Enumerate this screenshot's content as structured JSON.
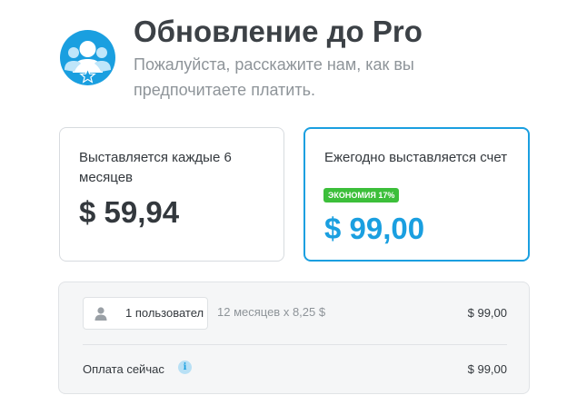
{
  "header": {
    "title": "Обновление до Pro",
    "subtitle": "Пожалуйста, расскажите нам, как вы предпочитаете платить.",
    "logo_icon": "users-star-icon",
    "accent_color": "#1a9fe0"
  },
  "plans": [
    {
      "label": "Выставляется каждые 6 месяцев",
      "price": "$ 59,94",
      "selected": false
    },
    {
      "label": "Ежегодно выставляется счет",
      "badge": "ЭКОНОМИЯ 17%",
      "badge_color": "#3cbf3a",
      "price": "$ 99,00",
      "selected": true
    }
  ],
  "summary": {
    "users_select_value": "1 пользовател",
    "user_icon": "user-icon",
    "months_text": "12 месяцев x 8,25 $",
    "line_price": "$ 99,00",
    "pay_now_label": "Оплата сейчас",
    "info_icon": "info-icon",
    "info_glyph": "i",
    "pay_now_price": "$ 99,00"
  }
}
